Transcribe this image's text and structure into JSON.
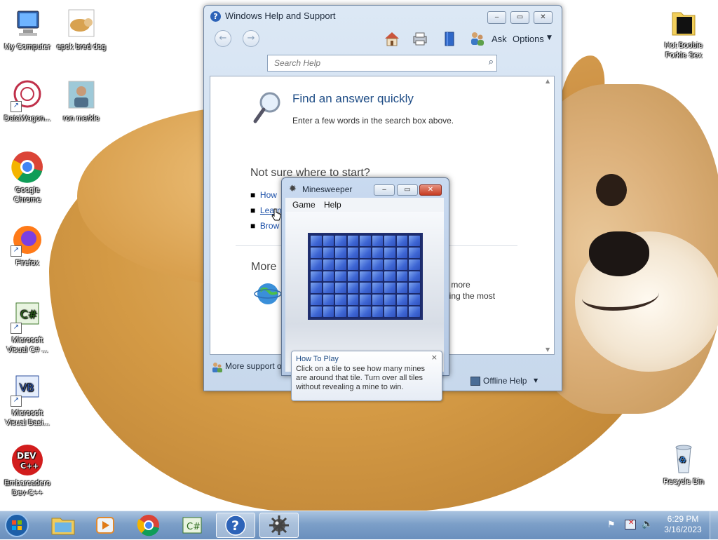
{
  "desktop": {
    "icons": [
      {
        "label": "My Computer",
        "icon": "computer-icon"
      },
      {
        "label": "epok bred dog",
        "icon": "image-file-icon"
      },
      {
        "label": "DataWagon...",
        "icon": "datawagon-icon"
      },
      {
        "label": "ron merkle",
        "icon": "user-photo-icon"
      },
      {
        "label": "Google Chrome",
        "icon": "chrome-icon"
      },
      {
        "label": "Firefox",
        "icon": "firefox-icon"
      },
      {
        "label": "Microsoft Visual C# ...",
        "icon": "visual-csharp-icon"
      },
      {
        "label": "Microsoft Visual Basi...",
        "icon": "visual-basic-icon"
      },
      {
        "label": "Embarcadero Dev-C++",
        "icon": "dev-cpp-icon"
      },
      {
        "label": "Hot Boobie Forkie Sex",
        "icon": "folder-icon"
      },
      {
        "label": "Recycle Bin",
        "icon": "recycle-bin-icon"
      }
    ]
  },
  "help_window": {
    "title": "Windows Help and Support",
    "toolbar": {
      "ask_label": "Ask",
      "options_label": "Options"
    },
    "search": {
      "placeholder": "Search Help"
    },
    "find_heading": "Find an answer quickly",
    "find_text": "Enter a few words in the search box above.",
    "not_sure_heading": "Not sure where to start?",
    "links": [
      "How",
      "Learn",
      "Brow"
    ],
    "more_heading": "More",
    "more_text_1": "s more",
    "more_text_2": "tting the most",
    "status_left": "More support o",
    "offline_label": "Offline Help"
  },
  "minesweeper": {
    "title": "Minesweeper",
    "menu": [
      "Game",
      "Help"
    ],
    "tip_title": "How To Play",
    "tip_text": "Click on a tile to see how many mines are around that tile. Turn over all tiles without revealing a mine to win.",
    "tip_close": "×"
  },
  "taskbar": {
    "clock_time": "6:29 PM",
    "clock_date": "3/16/2023",
    "items": [
      "start-orb-icon",
      "file-explorer-icon",
      "media-player-icon",
      "chrome-icon",
      "visual-csharp-icon",
      "help-icon",
      "minesweeper-icon"
    ]
  },
  "colors": {
    "accent": "#3e66d4",
    "taskbar": "#7c9fc8",
    "link": "#1a4fa8"
  }
}
